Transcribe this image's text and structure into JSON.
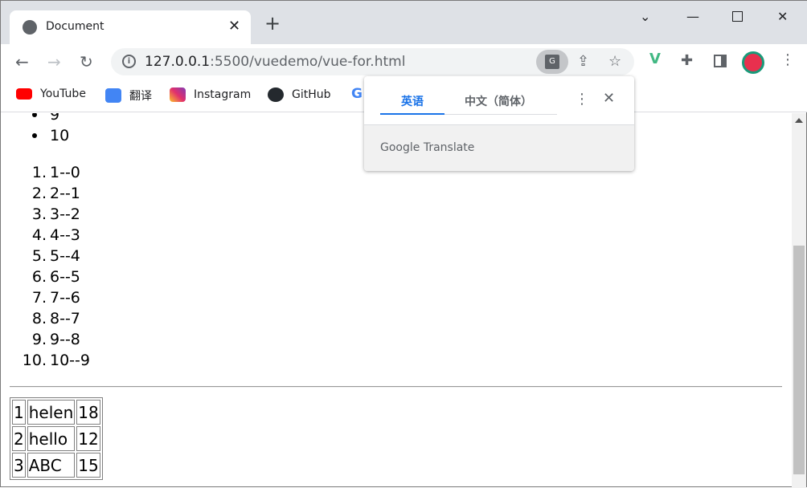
{
  "browser": {
    "tab_title": "Document",
    "url_host": "127.0.0.1",
    "url_path": ":5500/vuedemo/vue-for.html",
    "bookmarks": [
      {
        "label": "YouTube",
        "icon": "youtube-icon",
        "color": "#ff0000"
      },
      {
        "label": "翻译",
        "icon": "google-translate-icon",
        "color": "#4285f4"
      },
      {
        "label": "Instagram",
        "icon": "instagram-icon",
        "color": "#d6249f"
      },
      {
        "label": "GitHub",
        "icon": "github-icon",
        "color": "#24292e"
      }
    ]
  },
  "translate_popup": {
    "tab_source": "英语",
    "tab_target": "中文（简体）",
    "footer": "Google Translate",
    "accent": "#1a73e8"
  },
  "page": {
    "bullets": [
      "9",
      "10"
    ],
    "ordered": [
      "1--0",
      "2--1",
      "3--2",
      "4--3",
      "5--4",
      "6--5",
      "7--6",
      "8--7",
      "9--8",
      "10--9"
    ],
    "table": [
      [
        "1",
        "helen",
        "18"
      ],
      [
        "2",
        "hello",
        "12"
      ],
      [
        "3",
        "ABC",
        "15"
      ]
    ]
  }
}
